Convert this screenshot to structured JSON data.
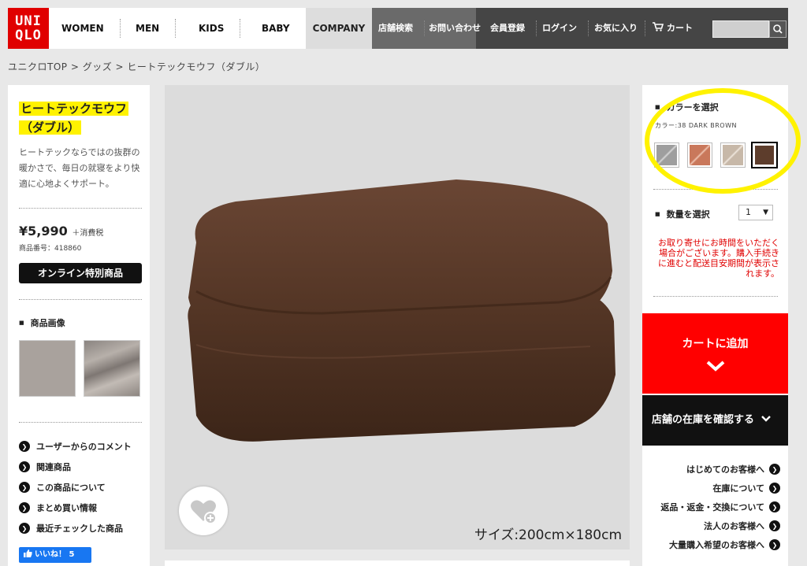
{
  "header": {
    "logo_top": "UNI",
    "logo_bottom": "QLO",
    "nav": [
      "WOMEN",
      "MEN",
      "KIDS",
      "BABY"
    ],
    "company": "COMPANY",
    "dark_links": [
      "店舗検索",
      "お問い合わせ",
      "会員登録",
      "ログイン",
      "お気に入り"
    ],
    "cart": "カート",
    "search_placeholder": ""
  },
  "breadcrumb": "ユニクロTOP > グッズ > ヒートテックモウフ（ダブル）",
  "product": {
    "title_line1": "ヒートテックモウフ",
    "title_line2": "（ダブル）",
    "description": "ヒートテックならではの抜群の暖かさで、毎日の就寝をより快適に心地よくサポート。",
    "price": "¥5,990",
    "tax_note": "＋消費税",
    "product_no": "商品番号：418860",
    "online_badge": "オンライン特別商品",
    "images_heading": "商品画像",
    "size_caption": "サイズ:200cm×180cm"
  },
  "left_links": [
    "ユーザーからのコメント",
    "関連商品",
    "この商品について",
    "まとめ買い情報",
    "最近チェックした商品"
  ],
  "like_button": "いいね！ 5",
  "options": {
    "color_heading": "カラーを選択",
    "color_selected": "カラー:38 DARK BROWN",
    "swatches": [
      "gray",
      "orange",
      "beige",
      "dark-brown"
    ],
    "qty_heading": "数量を選択",
    "qty_value": "1",
    "notice": "お取り寄せにお時間をいただく場合がございます。購入手続きに進むと配送目安期間が表示されます。"
  },
  "cart_button": "カートに追加",
  "store_button": "店舗の在庫を確認する",
  "help_links": [
    "はじめてのお客様へ",
    "在庫について",
    "返品・返金・交換について",
    "法人のお客様へ",
    "大量購入希望のお客様へ"
  ],
  "colors": {
    "brand_red": "#ff0000",
    "highlight": "#fff200",
    "blanket": "#5a3c2b"
  }
}
